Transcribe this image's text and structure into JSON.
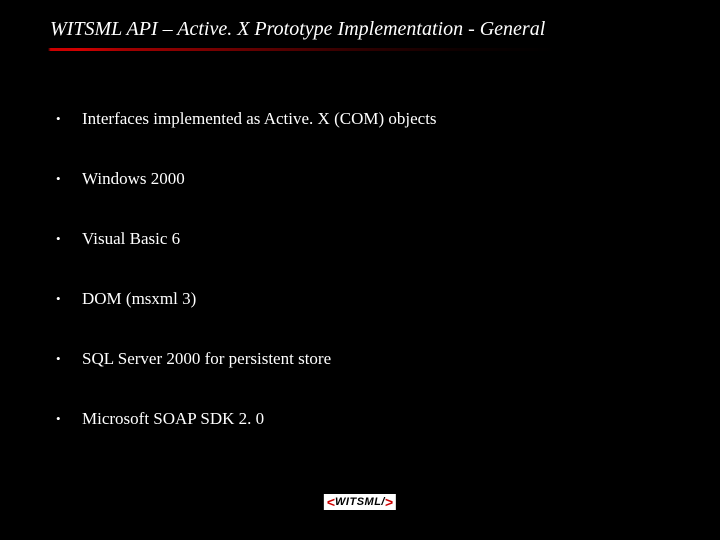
{
  "title": "WITSML API – Active. X Prototype Implementation - General",
  "bullets": [
    "Interfaces implemented as Active. X (COM) objects",
    "Windows 2000",
    "Visual Basic 6",
    "DOM (msxml 3)",
    "SQL Server 2000 for persistent store",
    "Microsoft SOAP SDK 2. 0"
  ],
  "logo": {
    "open": "<",
    "text": "WITSML/",
    "close": ">"
  }
}
